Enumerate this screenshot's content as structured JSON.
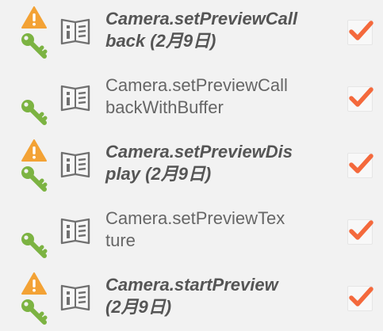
{
  "colors": {
    "warning": "#f3a235",
    "key": "#7cb342",
    "check": "#f4693c",
    "text": "#666666"
  },
  "items": [
    {
      "label": "Camera.setPreviewCall\nback (2月9日)",
      "bold": true,
      "warning": true,
      "checked": true,
      "icons": [
        "warning-icon",
        "key-icon",
        "book-icon",
        "checkmark-icon"
      ]
    },
    {
      "label": "Camera.setPreviewCall\nbackWithBuffer",
      "bold": false,
      "warning": false,
      "checked": true,
      "icons": [
        "key-icon",
        "book-icon",
        "checkmark-icon"
      ]
    },
    {
      "label": "Camera.setPreviewDis\nplay (2月9日)",
      "bold": true,
      "warning": true,
      "checked": true,
      "icons": [
        "warning-icon",
        "key-icon",
        "book-icon",
        "checkmark-icon"
      ]
    },
    {
      "label": "Camera.setPreviewTex\nture",
      "bold": false,
      "warning": false,
      "checked": true,
      "icons": [
        "key-icon",
        "book-icon",
        "checkmark-icon"
      ]
    },
    {
      "label": "Camera.startPreview\n(2月9日)",
      "bold": true,
      "warning": true,
      "checked": true,
      "icons": [
        "warning-icon",
        "key-icon",
        "book-icon",
        "checkmark-icon"
      ]
    }
  ]
}
